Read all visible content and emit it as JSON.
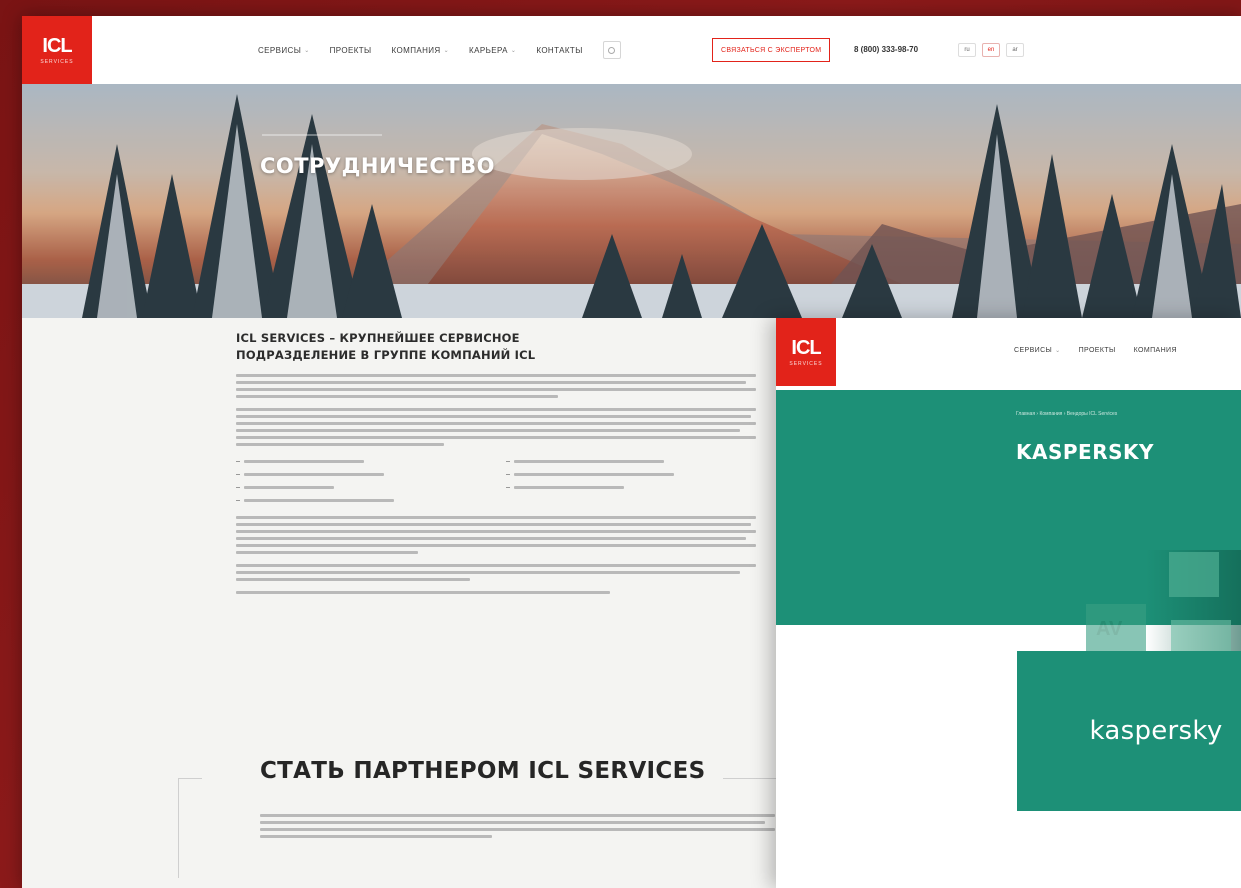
{
  "header": {
    "logo_text": "ICL",
    "logo_sub": "SERVICES",
    "nav": [
      {
        "label": "СЕРВИСЫ",
        "has_dropdown": true
      },
      {
        "label": "ПРОЕКТЫ",
        "has_dropdown": false
      },
      {
        "label": "КОМПАНИЯ",
        "has_dropdown": true
      },
      {
        "label": "КАРЬЕРА",
        "has_dropdown": true
      },
      {
        "label": "КОНТАКТЫ",
        "has_dropdown": false
      }
    ],
    "contact_button": "СВЯЗАТЬСЯ С ЭКСПЕРТОМ",
    "phone": "8 (800) 333-98-70",
    "langs": [
      "ru",
      "en",
      "ar"
    ],
    "active_lang": "en"
  },
  "hero": {
    "title": "СОТРУДНИЧЕСТВО"
  },
  "content": {
    "heading_line1": "ICL SERVICES – КРУПНЕЙШЕЕ СЕРВИСНОЕ",
    "heading_line2": "ПОДРАЗДЕЛЕНИЕ В ГРУППЕ КОМПАНИЙ ICL"
  },
  "partner": {
    "title": "СТАТЬ ПАРТНЕРОМ ICL SERVICES"
  },
  "card2": {
    "logo_text": "ICL",
    "logo_sub": "SERVICES",
    "nav": [
      "СЕРВИСЫ",
      "ПРОЕКТЫ",
      "КОМПАНИЯ"
    ],
    "breadcrumb": "Главная › Компания › Вендоры ICL Services",
    "title": "KASPERSKY",
    "brand_word": "kaspersky"
  },
  "colors": {
    "brand_red": "#e2231a",
    "kaspersky_green": "#1d9077",
    "backdrop": "#7a1414"
  }
}
